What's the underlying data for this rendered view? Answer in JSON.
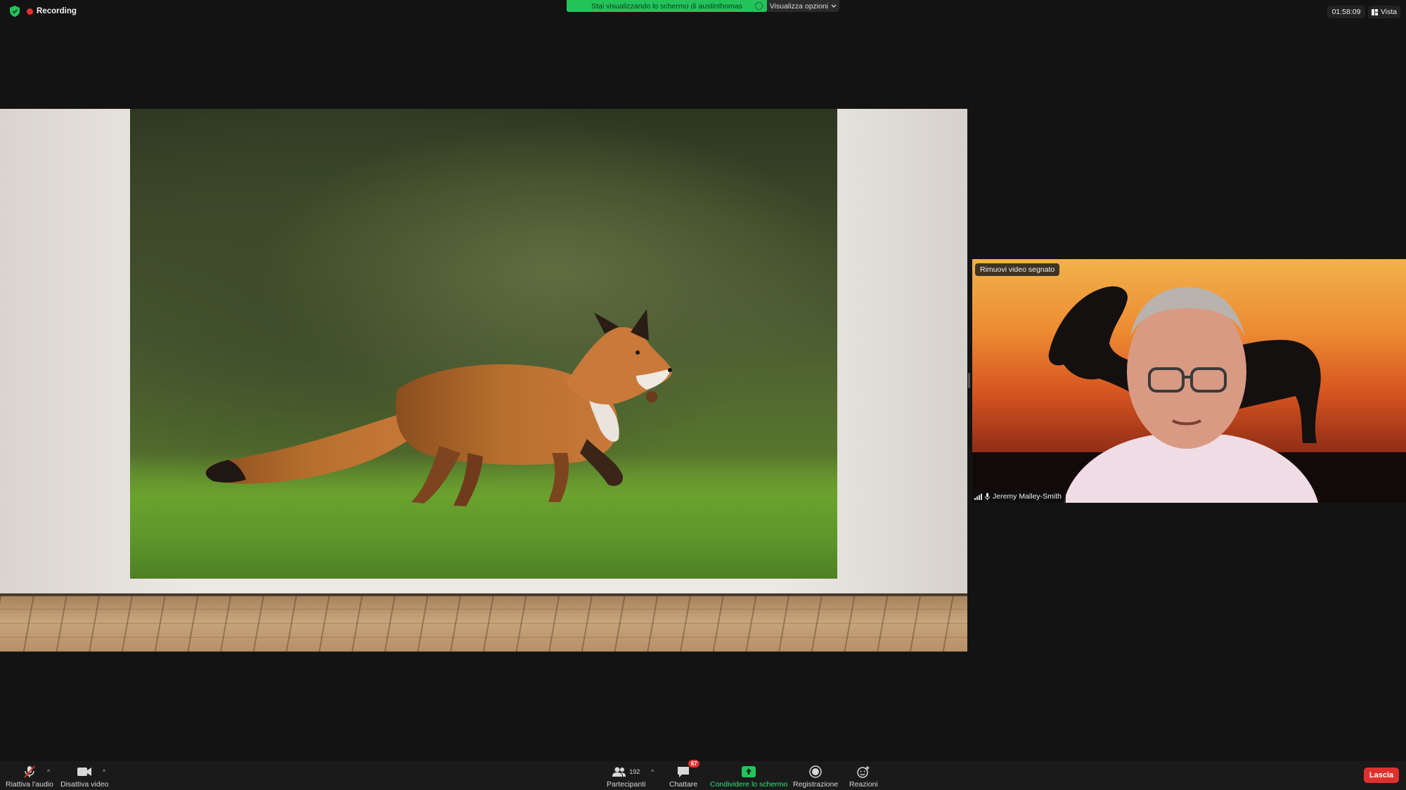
{
  "top": {
    "recording_label": "Recording",
    "share_banner": "Stai visualizzando lo schermo di austinthomas",
    "view_options": "Visualizza opzioni",
    "timer": "01:58:09",
    "view_label": "Vista"
  },
  "video": {
    "remove_pinned": "Rimuovi video segnato",
    "participant_name": "Jeremy Malley-Smith"
  },
  "toolbar": {
    "unmute": "Riattiva l'audio",
    "stop_video": "Disattiva video",
    "participants_label": "Partecipanti",
    "participants_count": "192",
    "chat_label": "Chattare",
    "chat_badge": "67",
    "share_label": "Condividere lo schermo",
    "record_label": "Registrazione",
    "reactions_label": "Reazioni",
    "leave_label": "Lascia"
  },
  "colors": {
    "share_green": "#23c35a",
    "leave_red": "#e0302e",
    "recording_red": "#e8312f"
  }
}
